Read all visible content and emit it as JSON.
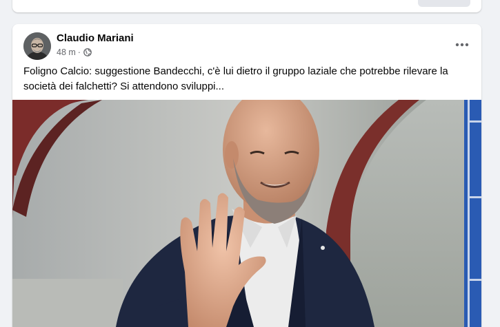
{
  "post": {
    "author": "Claudio Mariani",
    "time": "48 m",
    "separator": "·",
    "privacy_icon": "globe-icon",
    "more_icon": "more-options-icon",
    "text": "Foligno Calcio: suggestione Bandecchi, c'è lui dietro il gruppo laziale che potrebbe rilevare la società dei falchetti? Si attendono sviluppi...",
    "photo": "photo-of-smiling-bald-man-waving"
  },
  "colors": {
    "background": "#f0f2f5",
    "card": "#ffffff",
    "text_primary": "#050505",
    "text_secondary": "#65676b"
  }
}
